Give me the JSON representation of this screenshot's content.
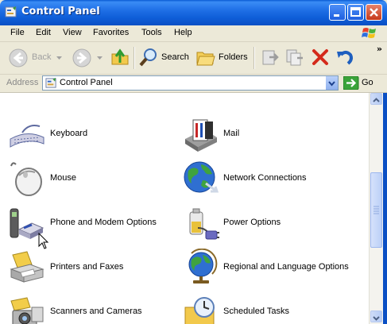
{
  "window": {
    "title": "Control Panel"
  },
  "menu": [
    "File",
    "Edit",
    "View",
    "Favorites",
    "Tools",
    "Help"
  ],
  "toolbar": {
    "back_label": "Back",
    "search_label": "Search",
    "folders_label": "Folders",
    "more": "»"
  },
  "address": {
    "label": "Address",
    "value": "Control Panel",
    "go_label": "Go"
  },
  "items": [
    {
      "label": "Keyboard",
      "icon": "keyboard-icon"
    },
    {
      "label": "Mail",
      "icon": "mail-icon"
    },
    {
      "label": "Mouse",
      "icon": "mouse-icon"
    },
    {
      "label": "Network Connections",
      "icon": "network-connections-icon"
    },
    {
      "label": "Phone and Modem Options",
      "icon": "phone-modem-icon"
    },
    {
      "label": "Power Options",
      "icon": "power-options-icon"
    },
    {
      "label": "Printers and Faxes",
      "icon": "printer-icon"
    },
    {
      "label": "Regional and Language Options",
      "icon": "globe-icon"
    },
    {
      "label": "Scanners and Cameras",
      "icon": "camera-icon"
    },
    {
      "label": "Scheduled Tasks",
      "icon": "clock-folder-icon"
    }
  ]
}
